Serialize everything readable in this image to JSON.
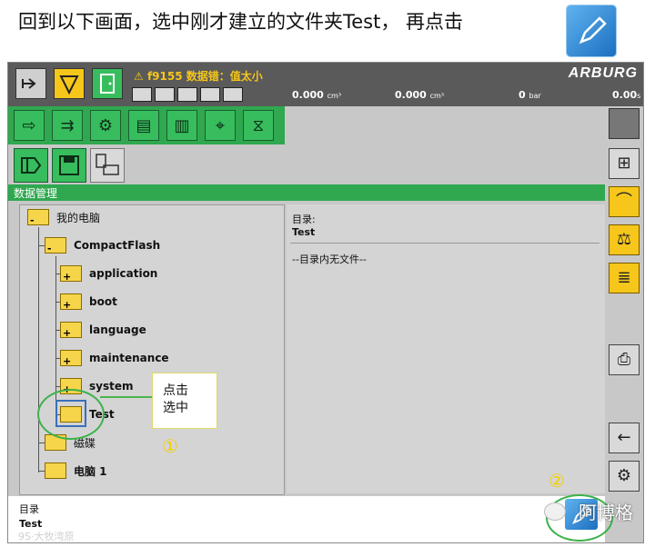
{
  "instruction": "回到以下画面，选中刚才建立的文件夹Test， 再点击",
  "header": {
    "brand": "ARBURG",
    "alarm": "f9155 数据错：值太小",
    "values": [
      {
        "value": "0.000",
        "unit": "cm³"
      },
      {
        "value": "0.000",
        "unit": "cm³"
      },
      {
        "value": "0",
        "unit": "bar"
      },
      {
        "value": "0.00",
        "unit": "s"
      }
    ]
  },
  "window_title": "数据管理",
  "tree": {
    "root": "我的电脑",
    "drive": "CompactFlash",
    "children": [
      "application",
      "boot",
      "language",
      "maintenance",
      "system",
      "Test"
    ],
    "others": [
      "磁碟",
      "电脑 1"
    ],
    "expand_symbol": "+",
    "collapse_symbol": "-"
  },
  "detail": {
    "dir_label": "目录:",
    "dir_value": "Test",
    "empty_msg": "--目录内无文件--"
  },
  "status": {
    "label": "目录",
    "value": "Test"
  },
  "callout": {
    "line1": "点击",
    "line2": "选中"
  },
  "steps": {
    "one": "①",
    "two": "②"
  },
  "watermark": {
    "account": "阿博格",
    "footer": "9S·大牧湾原"
  },
  "colors": {
    "green": "#2fa84f",
    "yellow": "#f6c61a",
    "folder": "#f7d54a",
    "edit_button": "#1c6fc0"
  }
}
